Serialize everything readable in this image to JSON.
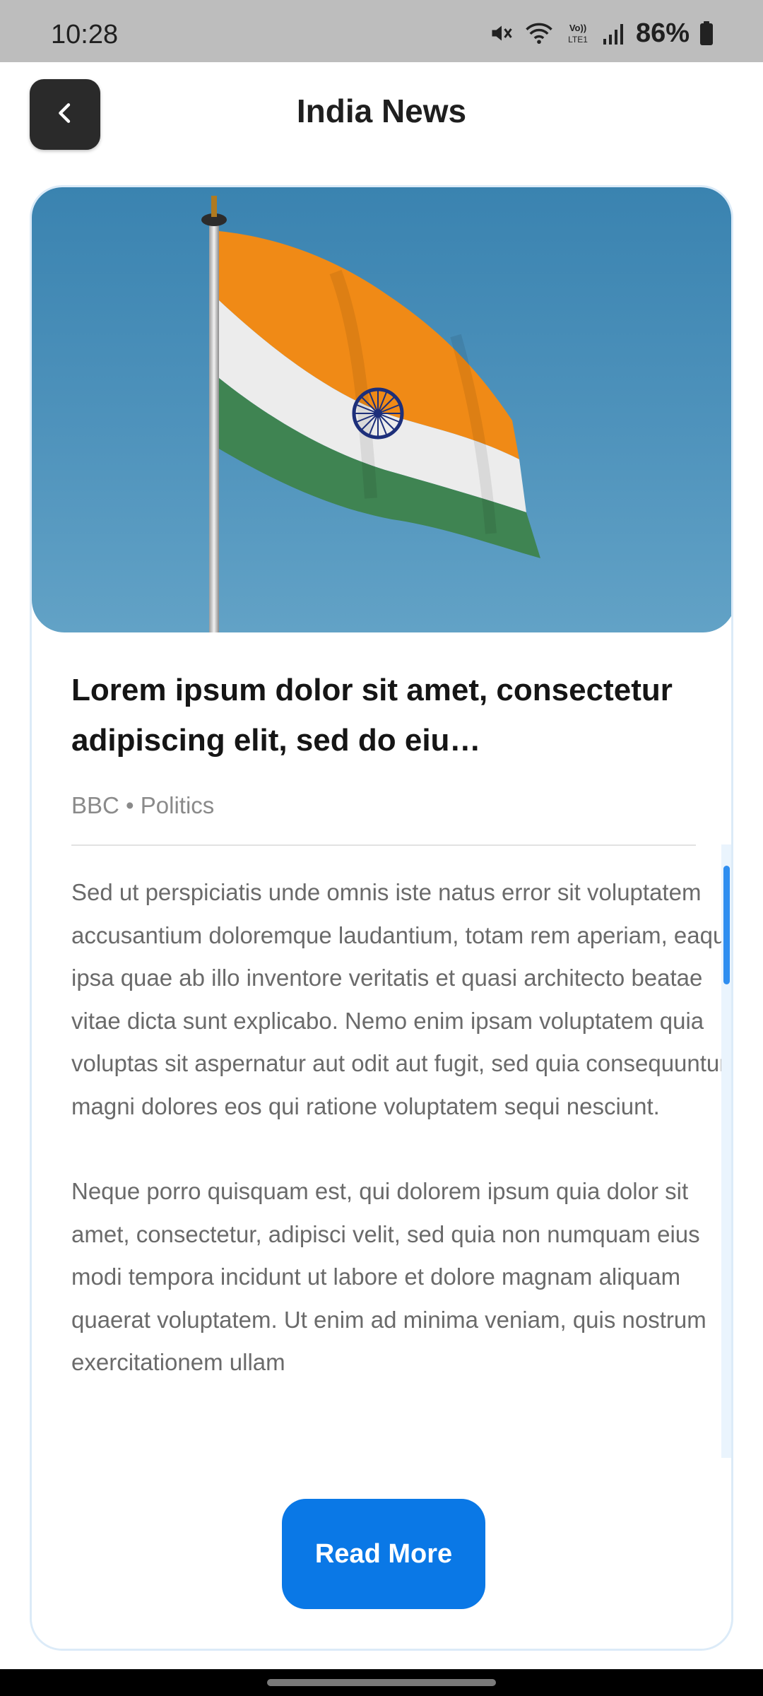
{
  "status_bar": {
    "time": "10:28",
    "battery": "86%",
    "network_label": "Vo)) LTE1",
    "icons": [
      "mute-icon",
      "wifi-icon",
      "volte-icon",
      "signal-icon",
      "battery-icon"
    ]
  },
  "header": {
    "title": "India News",
    "back_icon": "chevron-left-icon"
  },
  "article": {
    "image_subject": "indian-flag-image",
    "title": "Lorem ipsum dolor sit amet, consectetur adipiscing elit, sed do eiu…",
    "source": "BBC",
    "separator": "•",
    "category": "Politics",
    "paragraphs": [
      "Sed ut perspiciatis unde omnis iste natus error sit voluptatem accusantium doloremque laudantium, totam rem aperiam, eaque ipsa quae ab illo inventore veritatis et quasi architecto beatae vitae dicta sunt explicabo. Nemo enim ipsam voluptatem quia voluptas sit aspernatur aut odit aut fugit, sed quia consequuntur magni dolores eos qui ratione voluptatem sequi nesciunt.",
      "Neque porro quisquam est, qui dolorem ipsum quia dolor sit amet, consectetur, adipisci velit, sed quia non numquam eius modi tempora incidunt ut labore et dolore magnam aliquam quaerat voluptatem. Ut enim ad minima veniam, quis nostrum exercitationem ullam"
    ]
  },
  "actions": {
    "read_more_label": "Read More"
  },
  "colors": {
    "accent": "#0a78e6",
    "back_button": "#2a2a2a",
    "scroll_thumb": "#2f8ef0"
  }
}
